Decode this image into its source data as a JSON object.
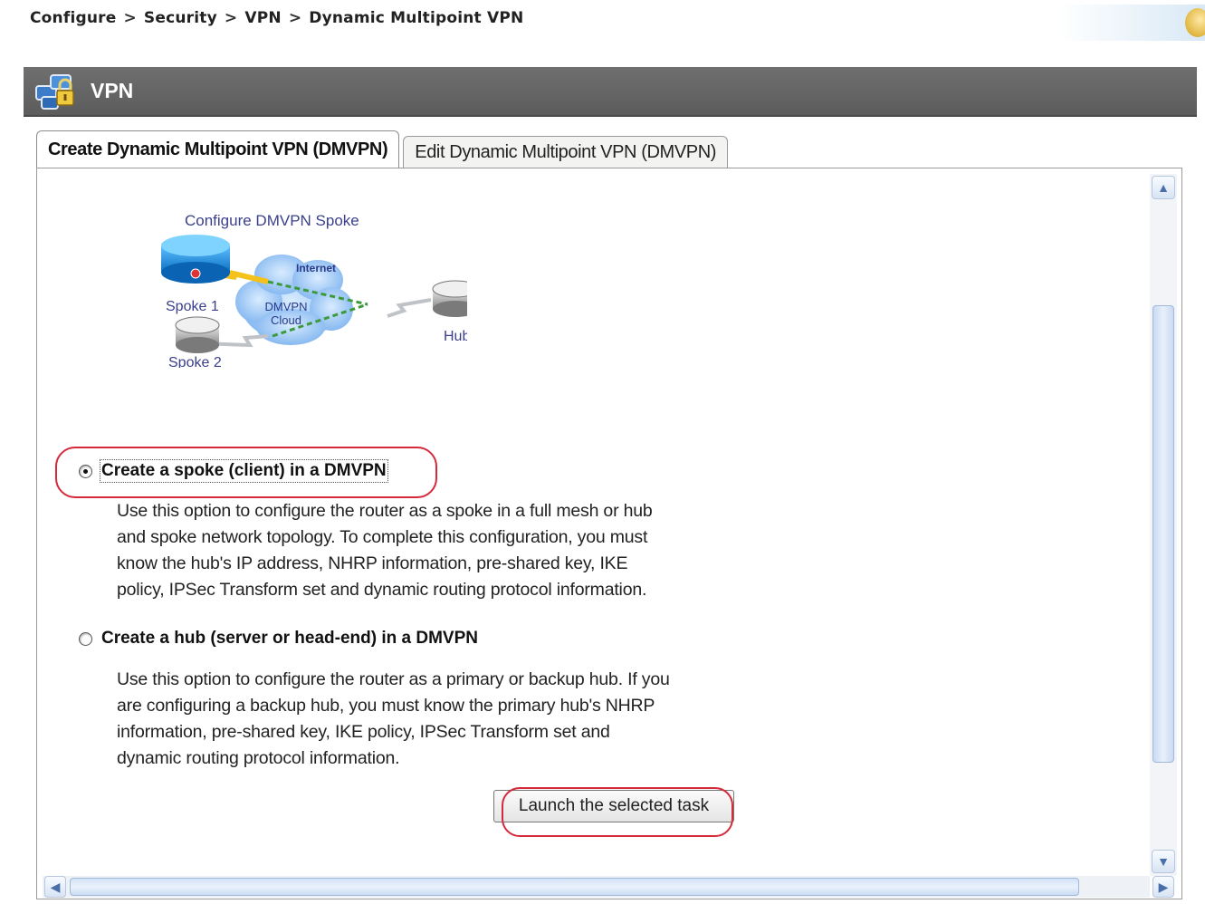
{
  "breadcrumb": {
    "items": [
      "Configure",
      "Security",
      "VPN",
      "Dynamic Multipoint VPN"
    ],
    "separator": ">"
  },
  "header": {
    "title": "VPN",
    "icon": "vpn-icon"
  },
  "tabs": [
    {
      "label": "Create Dynamic Multipoint VPN (DMVPN)",
      "active": true
    },
    {
      "label": "Edit Dynamic Multipoint VPN (DMVPN)",
      "active": false
    }
  ],
  "diagram": {
    "title": "Configure DMVPN Spoke",
    "labels": {
      "spoke1": "Spoke 1",
      "spoke2": "Spoke 2",
      "internet": "Internet",
      "cloud_line1": "DMVPN",
      "cloud_line2": "Cloud",
      "hub": "Hub"
    }
  },
  "options": {
    "spoke": {
      "label": "Create a spoke (client) in a DMVPN",
      "selected": true,
      "description": [
        "Use this option to configure the router as a spoke in a full mesh or hub",
        "and spoke network topology. To complete this configuration, you must",
        "know the hub's IP address, NHRP information, pre-shared key, IKE",
        "policy, IPSec Transform set and dynamic routing protocol information."
      ]
    },
    "hub": {
      "label": "Create a hub (server or head-end) in a DMVPN",
      "selected": false,
      "description": [
        "Use this option to configure the router as a primary or backup hub. If you",
        "are configuring a backup hub, you must know the primary hub's NHRP",
        "information, pre-shared key, IKE policy, IPSec Transform set and",
        "dynamic routing protocol information."
      ]
    }
  },
  "actions": {
    "launch_label": "Launch the selected task"
  },
  "colors": {
    "header_bg": "#636363",
    "highlight_outline": "#d42a3c",
    "diagram_title": "#3a3f8c"
  }
}
